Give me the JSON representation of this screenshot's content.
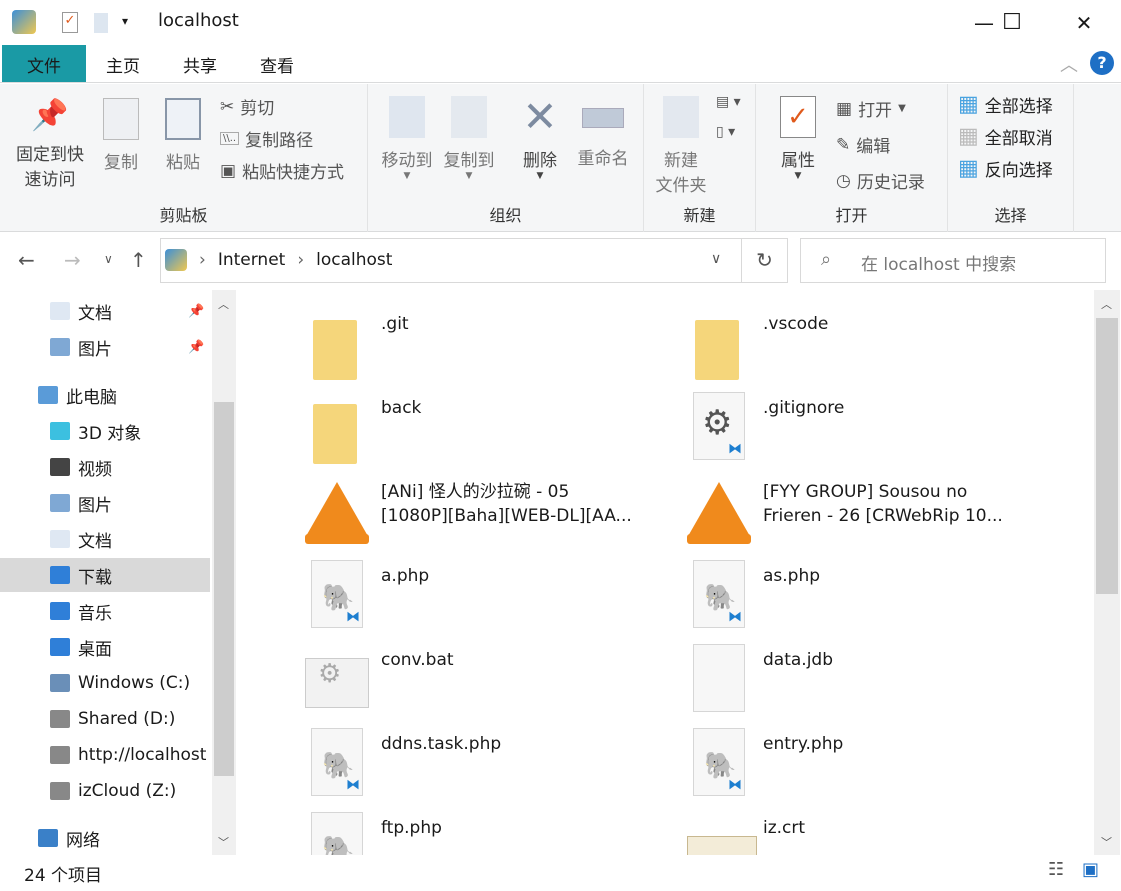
{
  "window": {
    "title": "localhost",
    "minimize": "—",
    "maximize": "☐",
    "close": "✕"
  },
  "tabs": [
    {
      "label": "文件"
    },
    {
      "label": "主页"
    },
    {
      "label": "共享"
    },
    {
      "label": "查看"
    }
  ],
  "ribbon": {
    "clipboard": {
      "label": "剪贴板",
      "pin": "固定到快",
      "pin2": "速访问",
      "copy": "复制",
      "paste": "粘贴",
      "cut": "剪切",
      "copy_path": "复制路径",
      "paste_shortcut": "粘贴快捷方式"
    },
    "organize": {
      "label": "组织",
      "move_to": "移动到",
      "copy_to": "复制到",
      "delete": "删除",
      "rename": "重命名"
    },
    "new": {
      "label": "新建",
      "new_folder": "新建",
      "new_folder2": "文件夹"
    },
    "open": {
      "label": "打开",
      "properties": "属性",
      "open": "打开",
      "edit": "编辑",
      "history": "历史记录"
    },
    "select": {
      "label": "选择",
      "select_all": "全部选择",
      "select_none": "全部取消",
      "invert": "反向选择"
    }
  },
  "address": {
    "path": [
      "Internet",
      "localhost"
    ],
    "search_placeholder": "在 localhost 中搜索"
  },
  "nav": [
    {
      "label": "文档",
      "icon": "document-icon",
      "pinned": true
    },
    {
      "label": "图片",
      "icon": "picture-icon",
      "pinned": true
    },
    {
      "label": "此电脑",
      "icon": "computer-icon"
    },
    {
      "label": "3D 对象",
      "icon": "cube-icon"
    },
    {
      "label": "视频",
      "icon": "video-icon"
    },
    {
      "label": "图片",
      "icon": "picture-icon"
    },
    {
      "label": "文档",
      "icon": "document-icon"
    },
    {
      "label": "下载",
      "icon": "download-icon",
      "selected": true
    },
    {
      "label": "音乐",
      "icon": "music-icon"
    },
    {
      "label": "桌面",
      "icon": "desktop-icon"
    },
    {
      "label": "Windows (C:)",
      "icon": "drive-icon"
    },
    {
      "label": "Shared (D:)",
      "icon": "network-drive-icon"
    },
    {
      "label": "http://localhost",
      "icon": "network-drive-icon"
    },
    {
      "label": "izCloud (Z:)",
      "icon": "network-drive-icon"
    },
    {
      "label": "网络",
      "icon": "network-icon"
    }
  ],
  "files": [
    {
      "name": ".git",
      "type": "folder"
    },
    {
      "name": ".vscode",
      "type": "folder"
    },
    {
      "name": "back",
      "type": "folder"
    },
    {
      "name": ".gitignore",
      "type": "config"
    },
    {
      "name": "[ANi] 怪人的沙拉碗 - 05 [1080P][Baha][WEB-DL][AA...",
      "type": "vlc"
    },
    {
      "name": "[FYY GROUP] Sousou no Frieren - 26 [CRWebRip 10...",
      "type": "vlc"
    },
    {
      "name": "a.php",
      "type": "php"
    },
    {
      "name": "as.php",
      "type": "php"
    },
    {
      "name": "conv.bat",
      "type": "bat"
    },
    {
      "name": "data.jdb",
      "type": "blank"
    },
    {
      "name": "ddns.task.php",
      "type": "php"
    },
    {
      "name": "entry.php",
      "type": "php"
    },
    {
      "name": "ftp.php",
      "type": "php"
    },
    {
      "name": "iz.crt",
      "type": "cert"
    }
  ],
  "status": {
    "count": "24 个项目"
  },
  "colors": {
    "file_tab": "#1a9aa5",
    "folder": "#f5d67b",
    "vlc": "#f08a1c",
    "php": "#8a5fb0",
    "selected": "#d9d9d9"
  }
}
